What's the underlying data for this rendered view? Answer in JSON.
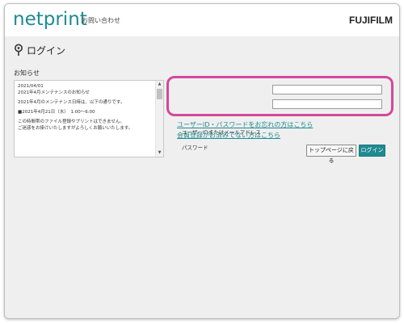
{
  "header": {
    "logo": "netprint",
    "contact_link": "お問い合わせ",
    "brand": "FUJIFILM"
  },
  "page": {
    "title": "ログイン"
  },
  "notice": {
    "label": "お知らせ",
    "lines": [
      "2021/04/01",
      "2021年4月メンテナンスのお知らせ",
      "2021年4月のメンテナンス日時は、以下の通りです。",
      "■2021年4月21日（水）　1:00〜6:00",
      "この時間帯のファイル登録やプリントはできません。",
      "ご迷惑をお掛けいたしますがよろしくお願いいたします。"
    ]
  },
  "login": {
    "user_label": "ユーザーIDまたはメールアドレス",
    "user_value": "",
    "password_label": "パスワード",
    "password_value": "",
    "forgot_link": "ユーザーID・パスワードをお忘れの方はこちら",
    "register_link": "会員登録がお済みでない方はこちら",
    "top_button": "トップページに戻る",
    "login_button": "ログイン"
  },
  "colors": {
    "accent": "#1f8a91",
    "highlight": "#d4489b",
    "panel_bg": "#efefef"
  }
}
